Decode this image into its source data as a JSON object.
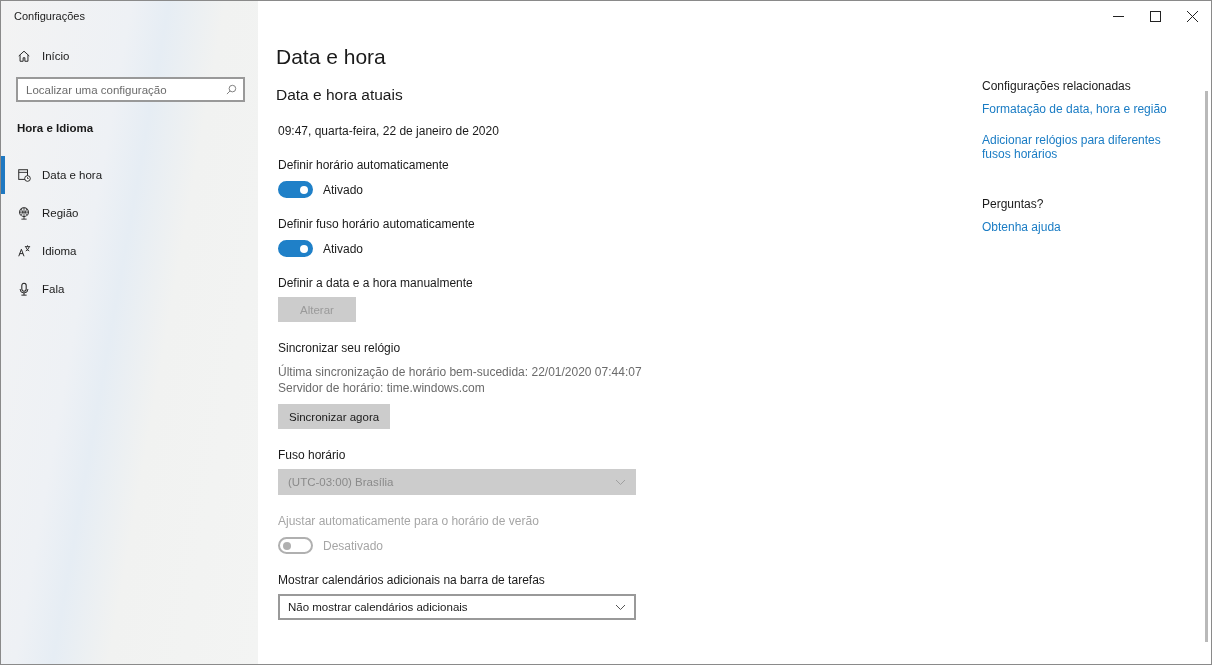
{
  "window": {
    "title": "Configurações"
  },
  "sidebar": {
    "home": "Início",
    "search": {
      "placeholder": "Localizar uma configuração"
    },
    "section": "Hora e Idioma",
    "items": [
      {
        "kind": "calendar",
        "label": "Data e hora",
        "selected": true
      },
      {
        "kind": "globe",
        "label": "Região",
        "selected": false
      },
      {
        "kind": "language",
        "label": "Idioma",
        "selected": false
      },
      {
        "kind": "microphone",
        "label": "Fala",
        "selected": false
      }
    ]
  },
  "main": {
    "title": "Data e hora",
    "subtitle": "Data e hora atuais",
    "current": "09:47, quarta-feira, 22 de janeiro de 2020",
    "settings": [
      {
        "kind": "toggle",
        "label": "Definir horário automaticamente",
        "on": true,
        "disabled": false,
        "state_text": "Ativado"
      },
      {
        "kind": "toggle",
        "label": "Definir fuso horário automaticamente",
        "on": true,
        "disabled": false,
        "state_text": "Ativado"
      },
      {
        "kind": "button",
        "label": "Definir a data e a hora manualmente",
        "button_label": "Alterar",
        "disabled": true
      },
      {
        "kind": "sync",
        "label": "Sincronizar seu relógio",
        "details": [
          "Última sincronização de horário bem-sucedida: 22/01/2020 07:44:07",
          "Servidor de horário: time.windows.com"
        ],
        "button_label": "Sincronizar agora",
        "disabled": false
      },
      {
        "kind": "dropdown",
        "label": "Fuso horário",
        "value": "(UTC-03:00) Brasília",
        "disabled": true
      },
      {
        "kind": "toggle",
        "label": "Ajustar automaticamente para o horário de verão",
        "on": false,
        "disabled": true,
        "state_text": "Desativado"
      },
      {
        "kind": "dropdown",
        "label": "Mostrar calendários adicionais na barra de tarefas",
        "value": "Não mostrar calendários adicionais",
        "disabled": false
      }
    ]
  },
  "related": [
    {
      "heading": "Configurações relacionadas",
      "links": [
        "Formatação de data, hora e região",
        "Adicionar relógios para diferentes fusos horários"
      ]
    },
    {
      "heading": "Perguntas?",
      "links": [
        "Obtenha ajuda"
      ]
    }
  ]
}
